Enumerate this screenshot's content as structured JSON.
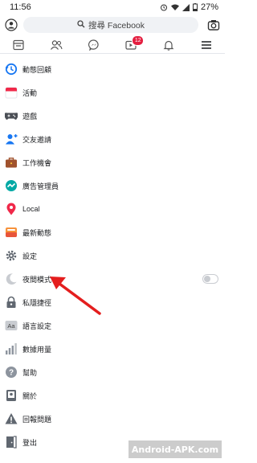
{
  "status_bar": {
    "time": "11:56",
    "battery": "27%"
  },
  "search": {
    "placeholder": "搜尋 Facebook"
  },
  "tabs": [
    {
      "name": "news-feed",
      "badge": ""
    },
    {
      "name": "friends",
      "badge": ""
    },
    {
      "name": "messenger",
      "badge": ""
    },
    {
      "name": "watch",
      "badge": "12"
    },
    {
      "name": "notifications",
      "badge": ""
    },
    {
      "name": "menu",
      "badge": ""
    }
  ],
  "menu": {
    "items": [
      {
        "label": "動態回顧",
        "icon": "memories-icon"
      },
      {
        "label": "活動",
        "icon": "events-icon"
      },
      {
        "label": "遊戲",
        "icon": "gaming-icon"
      },
      {
        "label": "交友邀請",
        "icon": "friend-requests-icon"
      },
      {
        "label": "工作機會",
        "icon": "jobs-icon"
      },
      {
        "label": "廣告管理員",
        "icon": "ads-manager-icon"
      },
      {
        "label": "Local",
        "icon": "location-pin-icon"
      },
      {
        "label": "最新動態",
        "icon": "most-recent-icon"
      },
      {
        "label": "設定",
        "icon": "settings-icon"
      },
      {
        "label": "夜間模式",
        "icon": "moon-icon",
        "toggle": "off"
      },
      {
        "label": "私隱捷徑",
        "icon": "privacy-lock-icon"
      },
      {
        "label": "語言設定",
        "icon": "language-icon"
      },
      {
        "label": "數據用量",
        "icon": "data-usage-icon"
      },
      {
        "label": "幫助",
        "icon": "help-icon"
      },
      {
        "label": "關於",
        "icon": "about-icon"
      },
      {
        "label": "回報問題",
        "icon": "report-problem-icon"
      },
      {
        "label": "登出",
        "icon": "log-out-icon"
      }
    ]
  },
  "watermark": "Android-APK.com",
  "colors": {
    "brand_blue": "#1877f2",
    "badge_red": "#e41e3f",
    "annotation_arrow": "#e41e1e"
  }
}
